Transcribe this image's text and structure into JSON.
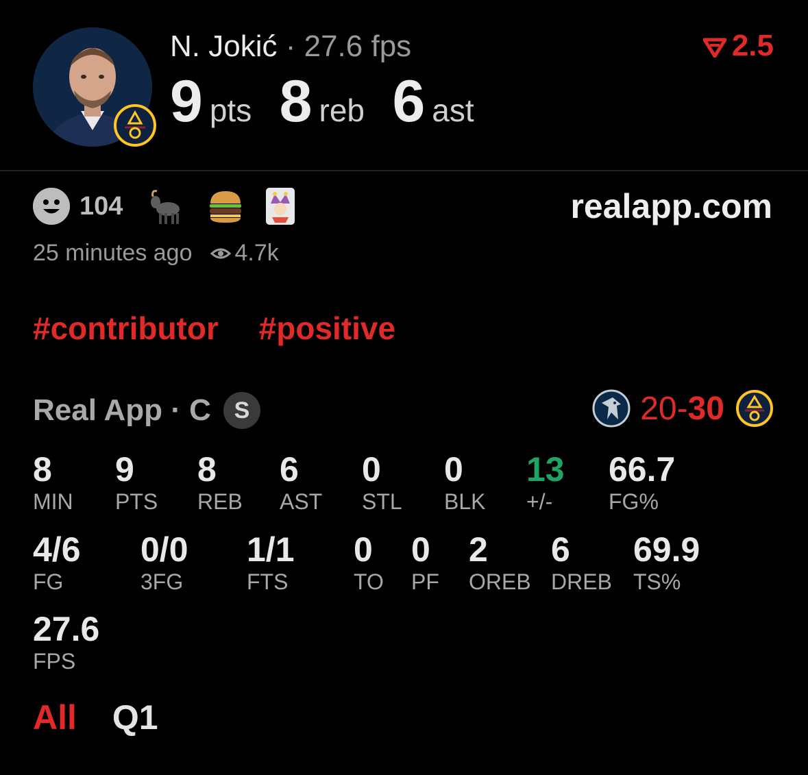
{
  "header": {
    "player_name": "N. Jokić",
    "separator": "·",
    "fps_text": "27.6 fps",
    "stats": [
      {
        "value": "9",
        "label": "pts"
      },
      {
        "value": "8",
        "label": "reb"
      },
      {
        "value": "6",
        "label": "ast"
      }
    ],
    "rating_icon": "red-down-v-icon",
    "rating_value": "2.5",
    "avatar_icon": "player-headshot-icon",
    "team_icon": "nuggets-logo-icon"
  },
  "reactions": {
    "smiley_icon": "smiley-face-icon",
    "count": "104",
    "emojis": [
      "goat-icon",
      "burger-icon",
      "joker-card-icon"
    ]
  },
  "site": "realapp.com",
  "meta": {
    "time_ago": "25 minutes ago",
    "views": "4.7k",
    "eye_icon": "eye-icon"
  },
  "tags": [
    "#contributor",
    "#positive"
  ],
  "league": {
    "text": "Real App · C",
    "badge": "S"
  },
  "game_score": {
    "away_logo": "mavericks-logo-icon",
    "away": "20",
    "sep": "-",
    "home": "30",
    "home_logo": "nuggets-logo-icon"
  },
  "stats_row1": [
    {
      "value": "8",
      "label": "MIN"
    },
    {
      "value": "9",
      "label": "PTS"
    },
    {
      "value": "8",
      "label": "REB"
    },
    {
      "value": "6",
      "label": "AST"
    },
    {
      "value": "0",
      "label": "STL"
    },
    {
      "value": "0",
      "label": "BLK"
    },
    {
      "value": "13",
      "label": "+/-"
    },
    {
      "value": "66.7",
      "label": "FG%"
    }
  ],
  "stats_row2": [
    {
      "value": "4/6",
      "label": "FG"
    },
    {
      "value": "0/0",
      "label": "3FG"
    },
    {
      "value": "1/1",
      "label": "FTS"
    },
    {
      "value": "0",
      "label": "TO"
    },
    {
      "value": "0",
      "label": "PF"
    },
    {
      "value": "2",
      "label": "OREB"
    },
    {
      "value": "6",
      "label": "DREB"
    },
    {
      "value": "69.9",
      "label": "TS%"
    }
  ],
  "stats_row3": [
    {
      "value": "27.6",
      "label": "FPS"
    }
  ],
  "period_tabs": [
    "All",
    "Q1"
  ],
  "colors": {
    "accent_red": "#e02a2a",
    "positive_green": "#1fa463",
    "background": "#000000"
  }
}
